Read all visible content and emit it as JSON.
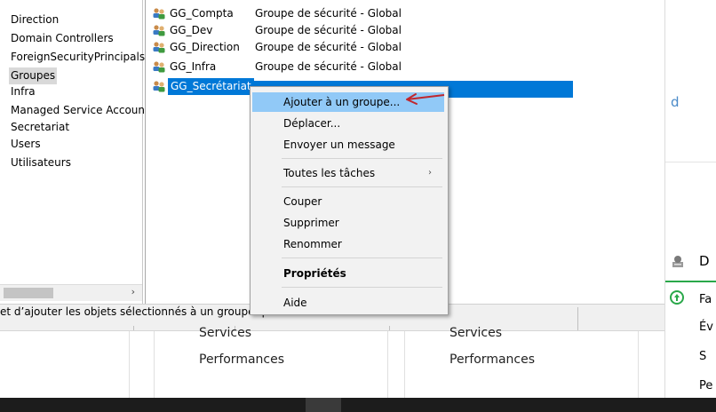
{
  "tree": {
    "items": [
      {
        "label": "Direction"
      },
      {
        "label": "Domain Controllers"
      },
      {
        "label": "ForeignSecurityPrincipals"
      },
      {
        "label": "Groupes",
        "selected": true
      },
      {
        "label": "Infra"
      },
      {
        "label": "Managed Service Accoun"
      },
      {
        "label": "Secretariat"
      },
      {
        "label": "Users"
      },
      {
        "label": "Utilisateurs"
      }
    ]
  },
  "list": {
    "rows": [
      {
        "name": "GG_Compta",
        "type": "Groupe de sécurité - Global"
      },
      {
        "name": "GG_Dev",
        "type": "Groupe de sécurité - Global"
      },
      {
        "name": "GG_Direction",
        "type": "Groupe de sécurité - Global"
      },
      {
        "name": "GG_Infra",
        "type": "Groupe de sécurité - Global"
      },
      {
        "name": "GG_Secrétariat",
        "type": "",
        "selected": true
      }
    ]
  },
  "context_menu": {
    "items": [
      {
        "label": "Ajouter à un groupe...",
        "highlighted": true
      },
      {
        "label": "Déplacer..."
      },
      {
        "label": "Envoyer un message"
      },
      {
        "label": "Toutes les tâches",
        "submenu": "›"
      },
      {
        "label": "Couper"
      },
      {
        "label": "Supprimer"
      },
      {
        "label": "Renommer"
      },
      {
        "label": "Propriétés",
        "bold": true
      },
      {
        "label": "Aide"
      }
    ]
  },
  "status_bar": {
    "text": "et d’ajouter les objets sélectionnés à un groupe que vous sélectionnerez."
  },
  "tree_scroll": {
    "right_arrow": "›"
  },
  "right_panel": {
    "link_fragment": "d",
    "heading_fragment": "D",
    "line1": "Fa",
    "line2": "Év",
    "line3": "S",
    "line4": "Pe"
  },
  "dashboard": {
    "col1_services": "Services",
    "col1_performances": "Performances",
    "col2_services": "Services",
    "col2_performances": "Performances"
  },
  "colors": {
    "selection": "#0078d7",
    "menu_highlight": "#91c9f7",
    "annotation_arrow": "#c0272d",
    "status_green": "#2aa84a"
  }
}
